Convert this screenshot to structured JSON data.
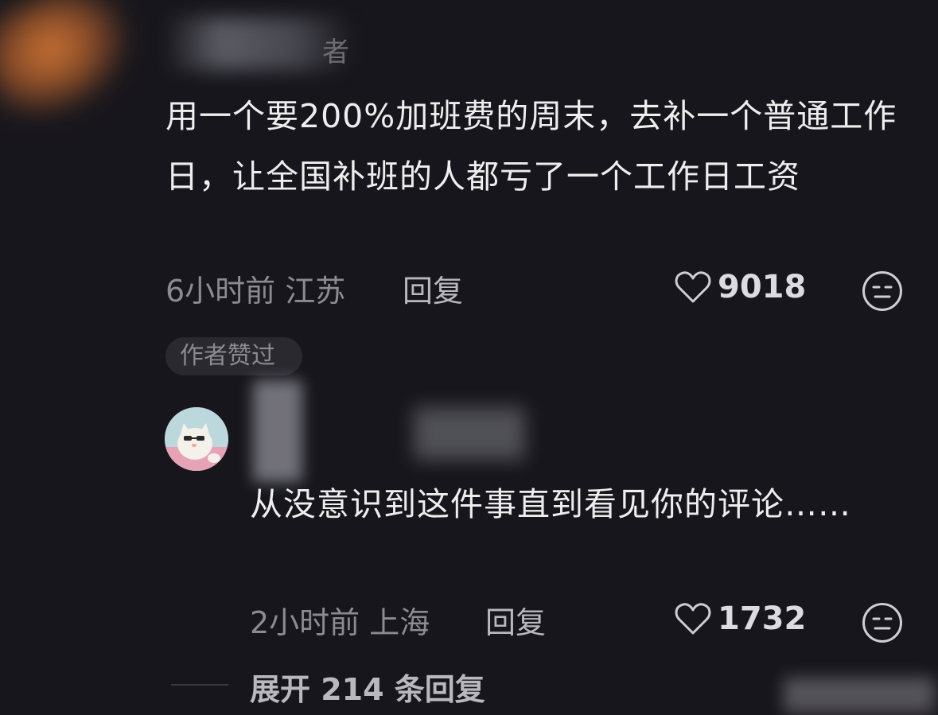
{
  "comment": {
    "author_hint": "者",
    "text": "用一个要200%加班费的周末，去补一个普通工作日，让全国补班的人都亏了一个工作日工资",
    "time_location": "6小时前 江苏",
    "reply_label": "回复",
    "likes": "9018",
    "author_badge": "作者赞过"
  },
  "reply": {
    "text": "从没意识到这件事直到看见你的评论……",
    "time_location": "2小时前 上海",
    "reply_label": "回复",
    "likes": "1732"
  },
  "expand": {
    "label": "展开 214 条回复"
  },
  "colors": {
    "background": "#17161c",
    "text_primary": "#eeeeee",
    "text_secondary": "#8c8b91"
  },
  "icons": {
    "like": "heart-outline-icon",
    "dislike": "dislike-face-icon"
  }
}
